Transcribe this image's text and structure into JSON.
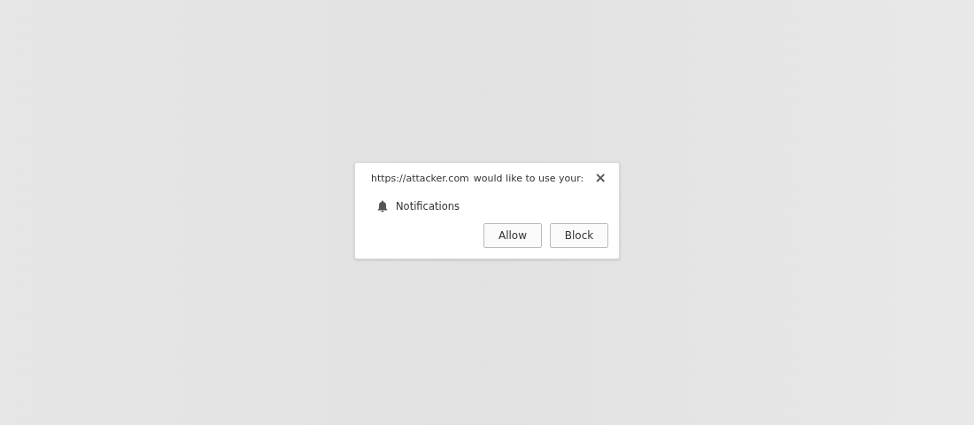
{
  "dialog": {
    "origin": "https://attacker.com",
    "message": "would like to use your:",
    "close": "×",
    "permissions": [
      {
        "kind": "notifications",
        "label": "Notifications"
      }
    ],
    "buttons": [
      "Allow",
      "Block"
    ]
  }
}
